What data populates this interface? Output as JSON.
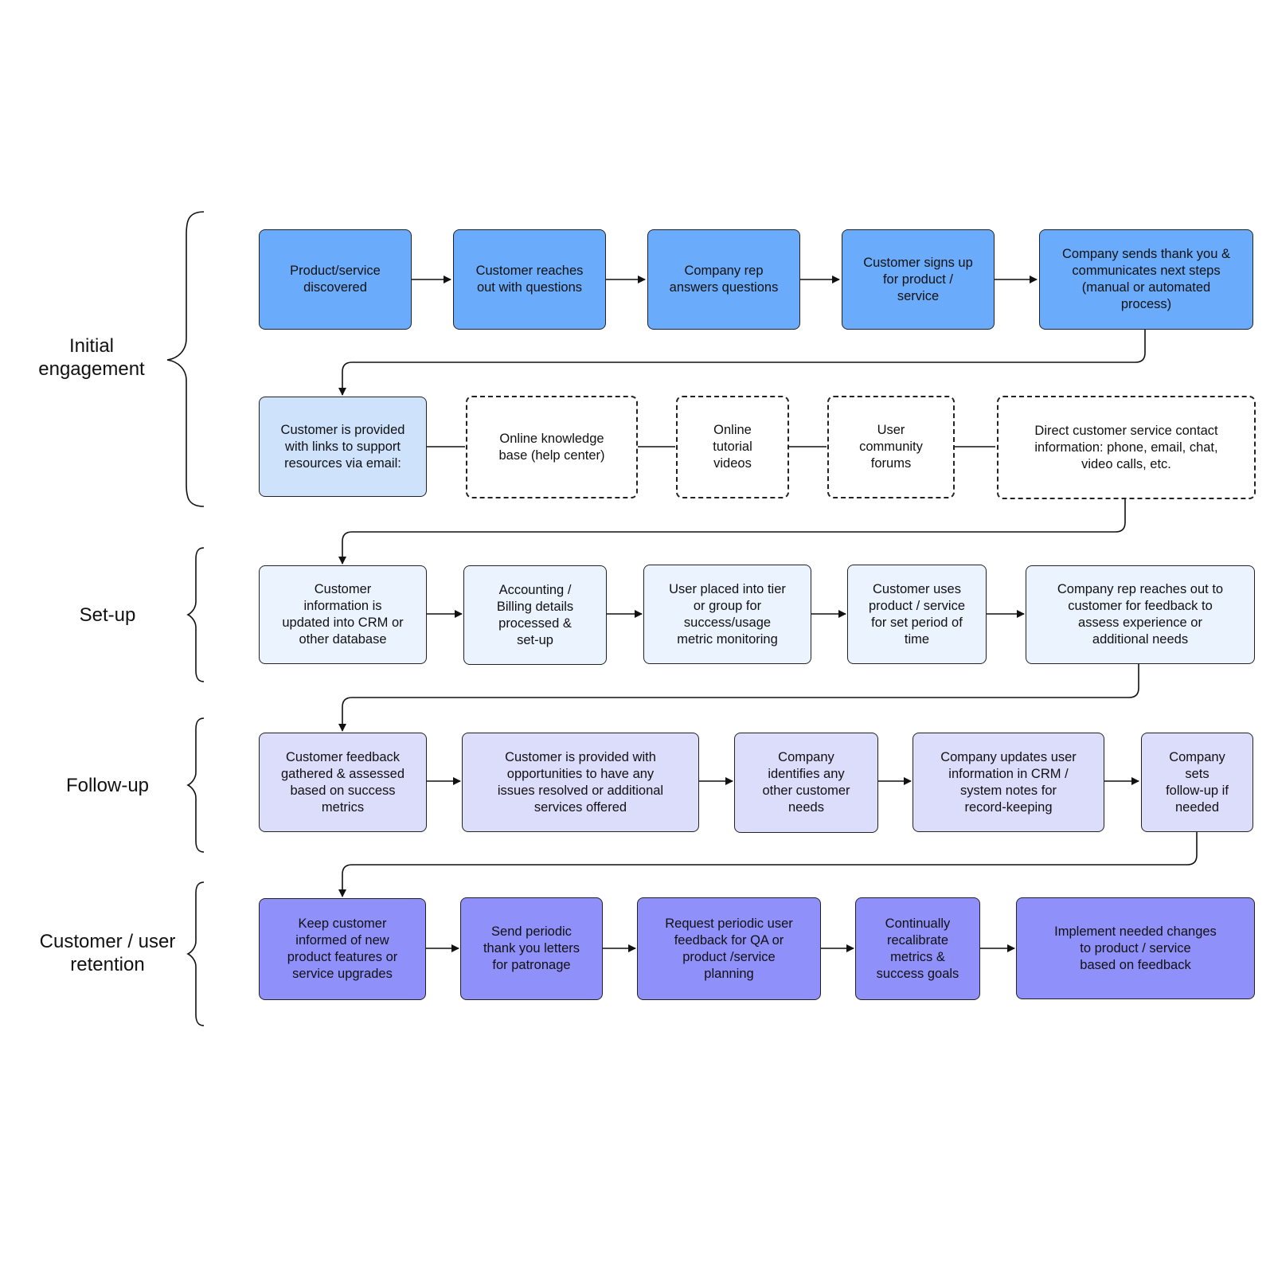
{
  "colors": {
    "initial": "#6aacfb",
    "initial_light": "#cfe2fc",
    "setup": "#ebf3fe",
    "followup": "#dcdcfb",
    "retention": "#9090fb"
  },
  "phases": [
    {
      "label": "Initial\nengagement"
    },
    {
      "label": "Set-up"
    },
    {
      "label": "Follow-up"
    },
    {
      "label": "Customer / user\nretention"
    }
  ],
  "rows": {
    "initial_1": [
      "Product/service\ndiscovered",
      "Customer reaches\nout with questions",
      "Company rep\nanswers questions",
      "Customer signs up\nfor product /\nservice",
      "Company sends thank you &\ncommunicates next steps\n(manual or automated\nprocess)"
    ],
    "initial_2": [
      "Customer is provided\nwith links to support\nresources via email:",
      "Online knowledge\nbase (help center)",
      "Online\ntutorial\nvideos",
      "User\ncommunity\nforums",
      "Direct customer service contact\ninformation: phone, email, chat,\nvideo calls, etc."
    ],
    "setup": [
      "Customer\ninformation is\nupdated into CRM or\nother database",
      "Accounting /\nBilling details\nprocessed &\nset-up",
      "User placed into tier\nor group for\nsuccess/usage\nmetric monitoring",
      "Customer uses\nproduct / service\nfor set period of\ntime",
      "Company rep reaches out to\ncustomer for feedback to\nassess experience or\nadditional needs"
    ],
    "followup": [
      "Customer feedback\ngathered & assessed\nbased on success\nmetrics",
      "Customer is provided with\nopportunities to have any\nissues resolved or additional\nservices offered",
      "Company\nidentifies any\nother customer\nneeds",
      "Company updates user\ninformation in CRM /\nsystem notes for\nrecord-keeping",
      "Company\nsets\nfollow-up if\nneeded"
    ],
    "retention": [
      "Keep customer\ninformed of new\nproduct features or\nservice upgrades",
      "Send periodic\nthank you letters\nfor patronage",
      "Request periodic user\nfeedback for QA or\nproduct /service\nplanning",
      "Continually\nrecalibrate\nmetrics &\nsuccess goals",
      "Implement needed changes\nto product / service\nbased on feedback"
    ]
  }
}
